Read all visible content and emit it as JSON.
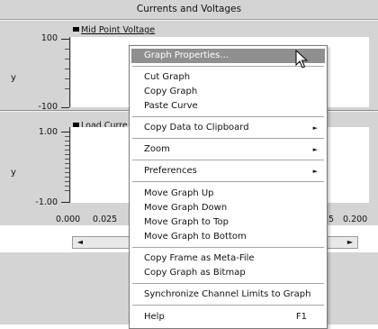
{
  "window": {
    "title": "Currents and Voltages"
  },
  "graph1": {
    "legend": "Mid Point Voltage",
    "ylabel": "y",
    "yticks": [
      "100",
      "-100"
    ]
  },
  "graph2": {
    "legend": "Load Curre",
    "ylabel": "y",
    "yticks": [
      "1.00",
      "-1.00"
    ]
  },
  "x_axis": {
    "ticks": [
      "0.000",
      "0.025",
      "5",
      "0.200"
    ]
  },
  "scrollbar": {
    "left_arrow": "◄",
    "right_arrow": "►"
  },
  "context_menu": {
    "items": [
      {
        "label": "Graph Properties..."
      },
      {
        "label": "Cut Graph"
      },
      {
        "label": "Copy Graph"
      },
      {
        "label": "Paste Curve"
      },
      {
        "label": "Copy Data to Clipboard"
      },
      {
        "label": "Zoom"
      },
      {
        "label": "Preferences"
      },
      {
        "label": "Move Graph Up"
      },
      {
        "label": "Move Graph Down"
      },
      {
        "label": "Move Graph to Top"
      },
      {
        "label": "Move Graph to Bottom"
      },
      {
        "label": "Copy Frame as Meta-File"
      },
      {
        "label": "Copy Graph as Bitmap"
      },
      {
        "label": "Synchronize Channel Limits to Graph"
      },
      {
        "label": "Help",
        "shortcut": "F1"
      }
    ],
    "submenu_arrow": "►"
  }
}
